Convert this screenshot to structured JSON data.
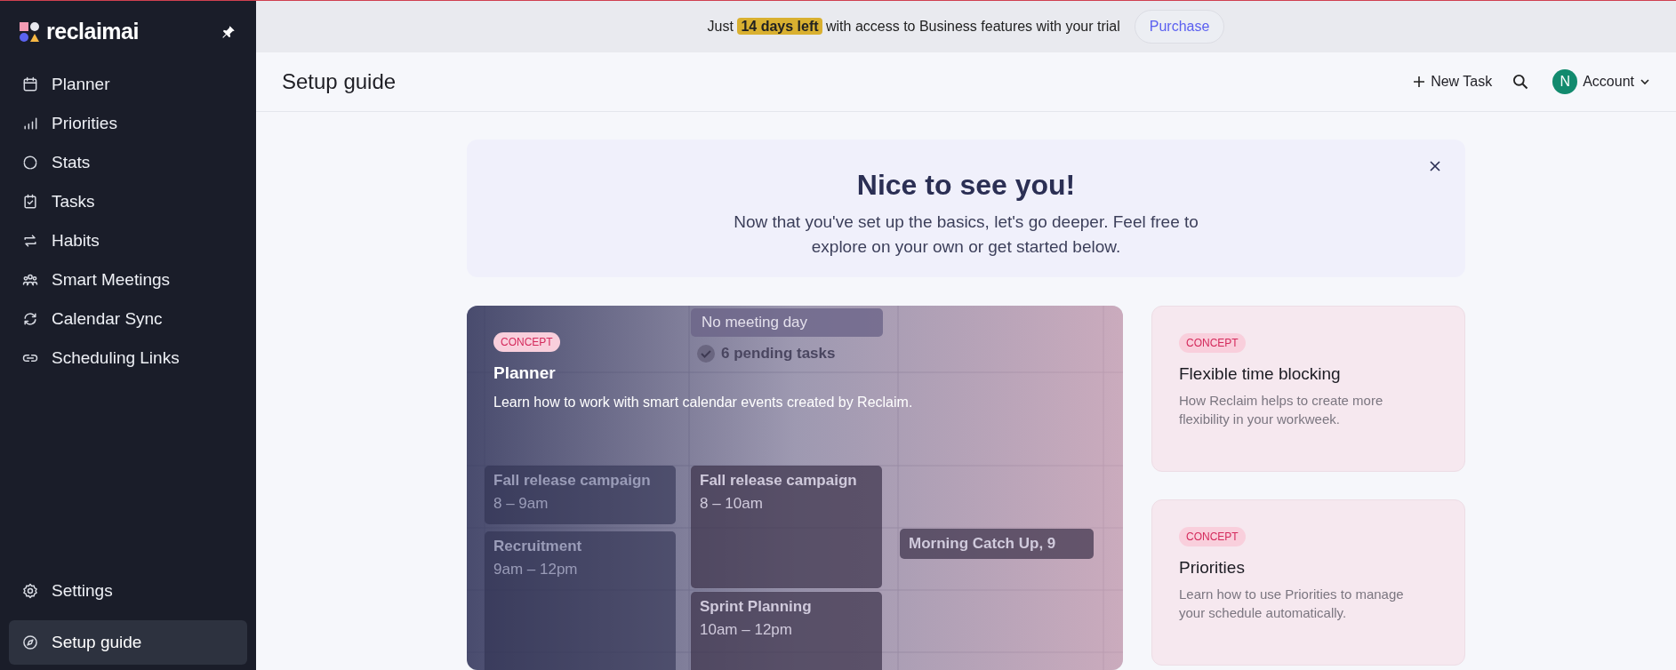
{
  "sidebar": {
    "brand": "reclaimai",
    "items": [
      {
        "label": "Planner",
        "selected": false
      },
      {
        "label": "Priorities",
        "selected": false
      },
      {
        "label": "Stats",
        "selected": false
      },
      {
        "label": "Tasks",
        "selected": false
      },
      {
        "label": "Habits",
        "selected": false
      },
      {
        "label": "Smart Meetings",
        "selected": false
      },
      {
        "label": "Calendar Sync",
        "selected": false
      },
      {
        "label": "Scheduling Links",
        "selected": false
      }
    ],
    "bottom_items": [
      {
        "label": "Settings",
        "selected": false
      },
      {
        "label": "Setup guide",
        "selected": true
      }
    ]
  },
  "trial_bar": {
    "text_before": "Just",
    "highlight": "14 days left",
    "text_after": "with access to Business features with your trial",
    "button": "Purchase"
  },
  "header": {
    "title": "Setup guide",
    "new_task": "New Task",
    "account_initial": "N",
    "account": "Account"
  },
  "welcome": {
    "title": "Nice to see you!",
    "text": "Now that you've set up the basics, let's go deeper. Feel free to explore on your own or get started below."
  },
  "cards": [
    {
      "kind": "feature",
      "tag": "CONCEPT",
      "title": "Planner",
      "text": "Learn how to work with smart calendar events created by Reclaim.",
      "preview": {
        "header_event": "No meeting day",
        "pending": "6 pending tasks",
        "events": [
          {
            "title": "Fall release campaign",
            "time": "8 – 9am"
          },
          {
            "title": "Recruitment",
            "time": "9am – 12pm"
          },
          {
            "title": "Fall release campaign",
            "time": "8 – 10am"
          },
          {
            "title": "Sprint Planning",
            "time": "10am – 12pm"
          },
          {
            "title": "Morning Catch Up, 9"
          }
        ]
      }
    },
    {
      "kind": "small",
      "tag": "CONCEPT",
      "title": "Flexible time blocking",
      "text": "How Reclaim helps to create more flexibility in your workweek."
    },
    {
      "kind": "small",
      "tag": "CONCEPT",
      "title": "Priorities",
      "text": "Learn how to use Priorities to manage your schedule automatically."
    }
  ]
}
